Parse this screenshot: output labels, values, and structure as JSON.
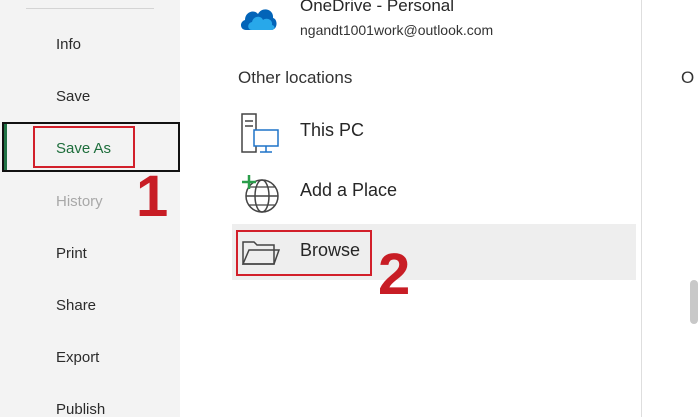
{
  "nav": {
    "items": [
      {
        "label": "Info",
        "state": "normal"
      },
      {
        "label": "Save",
        "state": "normal"
      },
      {
        "label": "Save As",
        "state": "selected"
      },
      {
        "label": "History",
        "state": "disabled"
      },
      {
        "label": "Print",
        "state": "normal"
      },
      {
        "label": "Share",
        "state": "normal"
      },
      {
        "label": "Export",
        "state": "normal"
      },
      {
        "label": "Publish",
        "state": "normal"
      }
    ]
  },
  "annotations": {
    "step1": "1",
    "step2": "2"
  },
  "onedrive": {
    "title": "OneDrive - Personal",
    "email": "ngandt1001work@outlook.com",
    "icon": "cloud-icon"
  },
  "other_locations": {
    "heading": "Other locations",
    "items": [
      {
        "label": "This PC",
        "icon": "computer-icon"
      },
      {
        "label": "Add a Place",
        "icon": "globe-add-icon"
      },
      {
        "label": "Browse",
        "icon": "folder-icon"
      }
    ]
  },
  "right_panel": {
    "heading_fragment": "O"
  },
  "colors": {
    "accent": "#217346",
    "annotation_red": "#d21f2a",
    "onedrive_blue": "#0364b8"
  }
}
